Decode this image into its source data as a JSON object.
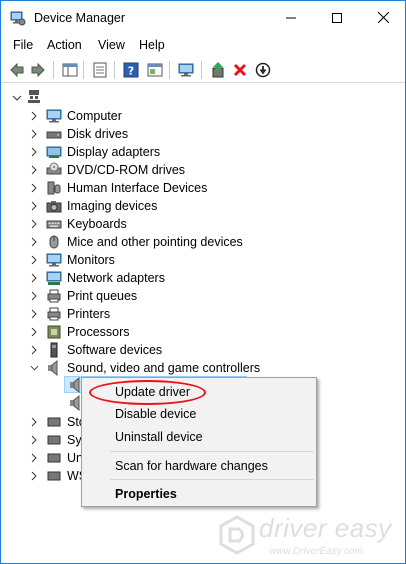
{
  "window": {
    "title": "Device Manager",
    "accent": "#1e7fd6"
  },
  "menu": {
    "file": "File",
    "action": "Action",
    "view": "View",
    "help": "Help"
  },
  "toolbar": {
    "icons": [
      "back-arrow-icon",
      "forward-arrow-icon",
      "show-hide-tree-icon",
      "properties-icon",
      "help-icon",
      "action-pane-icon",
      "scan-hardware-icon",
      "update-driver-icon",
      "uninstall-icon",
      "disable-icon"
    ],
    "uninstall_color": "#e8131b"
  },
  "tree": {
    "items": [
      {
        "label": "Computer",
        "icon": "computer-icon"
      },
      {
        "label": "Disk drives",
        "icon": "disk-drive-icon"
      },
      {
        "label": "Display adapters",
        "icon": "display-adapter-icon"
      },
      {
        "label": "DVD/CD-ROM drives",
        "icon": "dvd-drive-icon"
      },
      {
        "label": "Human Interface Devices",
        "icon": "hid-icon"
      },
      {
        "label": "Imaging devices",
        "icon": "camera-icon"
      },
      {
        "label": "Keyboards",
        "icon": "keyboard-icon"
      },
      {
        "label": "Mice and other pointing devices",
        "icon": "mouse-icon"
      },
      {
        "label": "Monitors",
        "icon": "monitor-icon"
      },
      {
        "label": "Network adapters",
        "icon": "network-adapter-icon"
      },
      {
        "label": "Print queues",
        "icon": "print-queue-icon"
      },
      {
        "label": "Printers",
        "icon": "printer-icon"
      },
      {
        "label": "Processors",
        "icon": "processor-icon"
      },
      {
        "label": "Software devices",
        "icon": "software-device-icon"
      },
      {
        "label": "Sound, video and game controllers",
        "icon": "speaker-icon"
      }
    ],
    "partial_items": [
      "Sto",
      "Sys",
      "Un",
      "WS"
    ]
  },
  "context_menu": {
    "update_driver": "Update driver",
    "disable_device": "Disable device",
    "uninstall_device": "Uninstall device",
    "scan": "Scan for hardware changes",
    "properties": "Properties",
    "highlight_color": "#e8131b"
  },
  "watermark": {
    "brand": "driver easy",
    "url": "www.DriverEasy.com"
  }
}
